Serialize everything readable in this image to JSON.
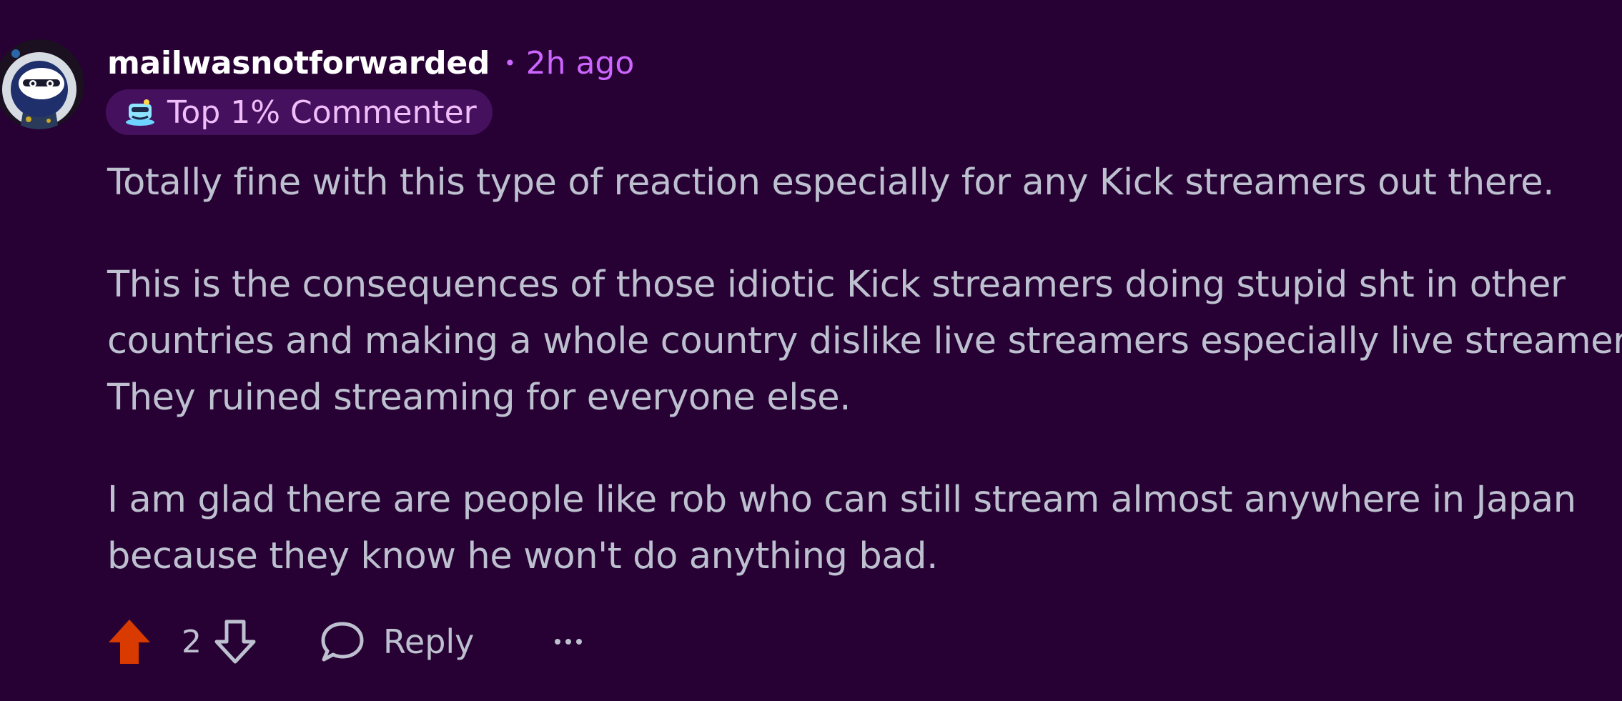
{
  "comment": {
    "author": "mailwasnotforwarded",
    "separator": "•",
    "time_ago": "2h ago",
    "badge": {
      "icon": "commenter-badge-icon",
      "label": "Top 1% Commenter"
    },
    "paragraphs": [
      "Totally fine with this type of reaction especially for any Kick streamers out there.",
      "This is the consequences of those idiotic Kick streamers doing stupid sht in other",
      "countries and making a whole country dislike live streamers especially live streamers.",
      "They ruined streaming for everyone else.",
      "I am glad there are people like rob who can still stream almost anywhere in Japan",
      "because they know he won't do anything bad."
    ],
    "actions": {
      "upvote_icon": "upvote-arrow-icon",
      "score": "2",
      "downvote_icon": "downvote-arrow-icon",
      "reply_icon": "speech-bubble-icon",
      "reply_label": "Reply",
      "more_icon": "ellipsis-icon"
    }
  },
  "colors": {
    "background": "#270134",
    "username": "#ffffff",
    "timestamp": "#cc66ff",
    "badge_background": "#45105e",
    "badge_text": "#f0bdf8",
    "body_text": "#bdc0cf",
    "upvote_active": "#d93a00"
  }
}
